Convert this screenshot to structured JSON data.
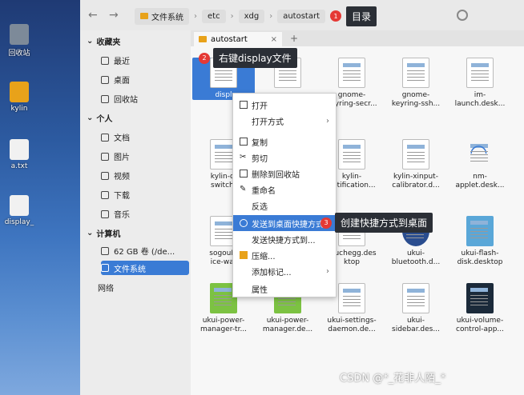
{
  "desktop": {
    "icons": [
      {
        "label": "回收站",
        "icon": "trash-icon",
        "color": "#7d8a99"
      },
      {
        "label": "kylin",
        "icon": "home-folder-icon",
        "color": "#e8a21a"
      },
      {
        "label": "a.txt",
        "icon": "text-file-icon",
        "color": "#f1f1f1"
      },
      {
        "label": "display_",
        "icon": "desktop-shortcut-icon",
        "color": "#f1f1f1"
      }
    ]
  },
  "topbar": {
    "back": "←",
    "forward": "→",
    "path": [
      "文件系统",
      "etc",
      "xdg",
      "autostart"
    ],
    "annotation_badge": "1",
    "annotation_text": "目录"
  },
  "tab": {
    "label": "autostart",
    "close": "×",
    "add": "+"
  },
  "annotation2": {
    "badge": "2",
    "text": "右键display文件"
  },
  "annotation3": {
    "badge": "3",
    "text": "创建快捷方式到桌面"
  },
  "sidebar": {
    "sections": [
      {
        "title": "收藏夹",
        "items": [
          "最近",
          "桌面",
          "回收站"
        ]
      },
      {
        "title": "个人",
        "items": [
          "文档",
          "图片",
          "视频",
          "下载",
          "音乐"
        ]
      },
      {
        "title": "计算机",
        "items": [
          "62 GB 卷 (/de...",
          "文件系统"
        ]
      },
      {
        "title": "网络",
        "items": []
      }
    ]
  },
  "files": [
    {
      "name": "displ"
    },
    {
      "name": ""
    },
    {
      "name": "gnome-\nkeyring-secr..."
    },
    {
      "name": "gnome-\nkeyring-ssh..."
    },
    {
      "name": "im-\nlaunch.desk..."
    },
    {
      "name": "kylin-di\nswitch-"
    },
    {
      "name": "kylin-\nnotification..."
    },
    {
      "name": "kylin-xinput-\ncalibrator.d..."
    },
    {
      "name": "nm-\napplet.desk..."
    },
    {
      "name": "sogouIn\nice-wat"
    },
    {
      "name": "touchegg.des\nktop"
    },
    {
      "name": "ukui-\nbluetooth.d..."
    },
    {
      "name": "ukui-flash-\ndisk.desktop"
    },
    {
      "name": "ukui-power-\nmanager-tr..."
    },
    {
      "name": "ukui-power-\nmanager.de..."
    },
    {
      "name": "ukui-settings-\ndaemon.de..."
    },
    {
      "name": "ukui-\nsidebar.des..."
    },
    {
      "name": "ukui-volume-\ncontrol-app..."
    }
  ],
  "context_menu": [
    {
      "label": "打开",
      "submenu": false
    },
    {
      "label": "打开方式",
      "submenu": true
    },
    {
      "label": "复制",
      "submenu": false
    },
    {
      "label": "剪切",
      "submenu": false
    },
    {
      "label": "删除到回收站",
      "submenu": false
    },
    {
      "label": "重命名",
      "submenu": false
    },
    {
      "label": "反选",
      "submenu": false
    },
    {
      "label": "发送到桌面快捷方式",
      "submenu": false
    },
    {
      "label": "发送快捷方式到...",
      "submenu": false
    },
    {
      "label": "压缩...",
      "submenu": false
    },
    {
      "label": "添加标记...",
      "submenu": true
    },
    {
      "label": "属性",
      "submenu": false
    }
  ],
  "watermark": "CSDN @*_花非人陌_*",
  "colors": {
    "accent": "#3a7bd5",
    "badge": "#e53935",
    "tag_bg": "#2b2f36"
  }
}
